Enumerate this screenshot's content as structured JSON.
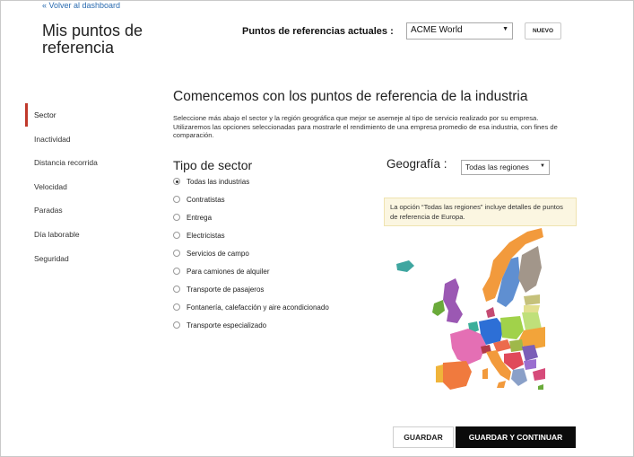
{
  "header": {
    "back_link": "« Volver al dashboard",
    "title": "Mis puntos de referencia",
    "refs_label": "Puntos de referencias actuales :",
    "refs_selected": "ACME World",
    "new_button": "NUEVO"
  },
  "sidebar": {
    "items": [
      {
        "label": "Sector",
        "active": true
      },
      {
        "label": "Inactividad"
      },
      {
        "label": "Distancia recorrida"
      },
      {
        "label": "Velocidad"
      },
      {
        "label": "Paradas"
      },
      {
        "label": "Día laborable"
      },
      {
        "label": "Seguridad"
      }
    ]
  },
  "main": {
    "heading": "Comencemos con los puntos de referencia de la industria",
    "intro": "Seleccione más abajo el sector y la región geográfica que mejor se asemeje al tipo de servicio realizado por su empresa. Utilizaremos las opciones seleccionadas para mostrarle el rendimiento de una empresa promedio de esa industria, con fines de comparación.",
    "sector": {
      "heading": "Tipo de sector",
      "options": [
        {
          "label": "Todas las industrias",
          "checked": true
        },
        {
          "label": "Contratistas"
        },
        {
          "label": "Entrega"
        },
        {
          "label": "Electricistas"
        },
        {
          "label": "Servicios de campo"
        },
        {
          "label": "Para camiones de alquiler"
        },
        {
          "label": "Transporte de pasajeros"
        },
        {
          "label": "Fontanería, calefacción y aire acondicionado"
        },
        {
          "label": "Transporte especializado"
        }
      ]
    },
    "geography": {
      "heading": "Geografía :",
      "selected": "Todas las regiones",
      "info": "La opción “Todas las regiones” incluye detalles de puntos de referencia de Europa."
    }
  },
  "footer": {
    "save_label": "GUARDAR",
    "save_continue_label": "GUARDAR Y CONTINUAR"
  },
  "colors": {
    "accent": "#c0392b",
    "primary_button": "#0b0b0b",
    "info_background": "#fbf6e1",
    "link": "#2b6cb0"
  }
}
